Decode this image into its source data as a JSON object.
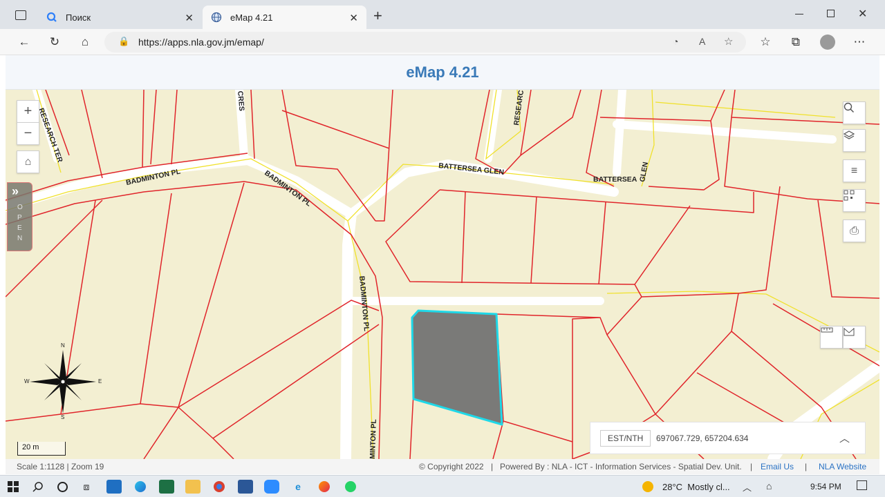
{
  "browser": {
    "tabs": [
      {
        "label": "Поиск",
        "icon": "search-q-icon"
      },
      {
        "label": "eMap 4.21",
        "icon": "globe-icon"
      }
    ],
    "new_tab_symbol": "+",
    "url": "https://apps.nla.gov.jm/emap/",
    "window_controls": [
      "minimize",
      "maximize",
      "close"
    ]
  },
  "app": {
    "title": "eMap 4.21",
    "side_panel_label": "OPEN"
  },
  "map": {
    "road_labels": [
      "RESEARCH TER",
      "CRES",
      "BADMINTON PL",
      "BADMINTON PL",
      "RESEARC",
      "BATTERSEA GLEN",
      "BATTERSEA",
      "GLEN",
      "BADMINTON PL",
      "MINTON PL"
    ],
    "compass": {
      "n": "N",
      "s": "S",
      "e": "E",
      "w": "W"
    },
    "scale_bar_label": "20 m",
    "coordinates": {
      "label": "EST/NTH",
      "value": "697067.729, 657204.634"
    },
    "colors": {
      "parcel": "#e0242a",
      "road_fill": "#ffffff",
      "centerline": "#f0e12a",
      "selection": "#1fd8e8",
      "selected_fill": "#7a7a78",
      "background": "#f3efd2"
    }
  },
  "status": {
    "scale_zoom": "Scale 1:1128 | Zoom 19",
    "copyright": "© Copyright 2022",
    "separator": "|",
    "powered_by": "Powered By : NLA - ICT - Information Services - Spatial Dev. Unit.",
    "email": "Email Us",
    "website": "NLA Website"
  },
  "taskbar": {
    "weather": "28°C  Mostly cl...",
    "time": "9:54 PM"
  }
}
